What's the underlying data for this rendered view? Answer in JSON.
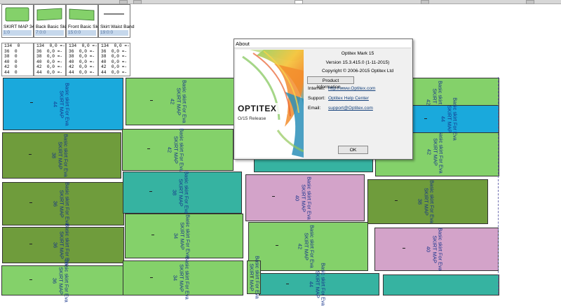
{
  "palette": [
    {
      "name": "SKIRT MAP 34",
      "value": "1:0",
      "color": "#84d16a",
      "shape": "rect"
    },
    {
      "name": "Back Basic Skirt",
      "value": "7:0:0",
      "color": "#84d16a",
      "shape": "trap"
    },
    {
      "name": "Front Basic Skirt",
      "value": "15:0:0",
      "color": "#84d16a",
      "shape": "trap"
    },
    {
      "name": "Skirt Waist Band",
      "value": "19:0:0",
      "color": "#000000",
      "shape": "line"
    }
  ],
  "sizes_table": [
    [
      "134  0",
      "36  0",
      "38  0",
      "40  0",
      "42  0",
      "44  0"
    ],
    [
      "134  0,0 =-",
      "36  0,0 =-",
      "38  0,0 =-",
      "40  0,0 =-",
      "42  0,0 =-",
      "44  0,0 =-"
    ],
    [
      "134  0,0 =-",
      "36  0,0 =-",
      "38  0,0 =-",
      "40  0,0 =-",
      "42  0,0 =-",
      "44  0,0 =-"
    ],
    [
      "134  0,0 =-",
      "36  0,0 =-",
      "38  0,0 =-",
      "40  0,0 =-",
      "42  0,0 =-",
      "44  0,0 =-"
    ]
  ],
  "piece_prefix": "Basic skirt For Eva",
  "piece_map": "SKIRT MAP",
  "pieces": [
    {
      "size": "44",
      "color": "blue"
    },
    {
      "size": "42",
      "color": "lgreen"
    },
    {
      "size": "38",
      "color": "dgreen"
    },
    {
      "size": "42",
      "color": "lgreen"
    },
    {
      "size": "36",
      "color": "dgreen"
    },
    {
      "size": "38",
      "color": "teal"
    },
    {
      "size": "40",
      "color": "pink"
    },
    {
      "size": "38",
      "color": "dgreen"
    },
    {
      "size": "36",
      "color": "dgreen"
    },
    {
      "size": "34",
      "color": "lgreen"
    },
    {
      "size": "42",
      "color": "lgreen"
    },
    {
      "size": "40",
      "color": "pink"
    },
    {
      "size": "36",
      "color": "lgreen"
    },
    {
      "size": "34",
      "color": "lgreen"
    },
    {
      "size": "44",
      "color": "teal"
    },
    {
      "size": "44",
      "color": "teal"
    },
    {
      "size": "42",
      "color": "lgreen"
    },
    {
      "size": "42",
      "color": "lgreen"
    },
    {
      "size": "",
      "color": "teal"
    },
    {
      "size": "44",
      "color": "blue"
    },
    {
      "size": "",
      "color": "lgreen"
    }
  ],
  "about": {
    "title": "About",
    "product": "Optitex Mark 15",
    "version": "Version 15.3.415.0 (1-11-2015)",
    "copyright": "Copyright © 2006-2015 Optitex Ltd",
    "product_info_button": "Product Information...",
    "internet_label": "Internet:",
    "internet_value": "http://www.Optitex.com",
    "support_label": "Support:",
    "support_value": "Optitex Help Center",
    "email_label": "Email:",
    "email_value": "support@Optitex.com",
    "ok_button": "OK",
    "logo_text": "OPTITEX",
    "release_text": "O/15 Release"
  },
  "colors": {
    "blue": "#1aa9dc",
    "lgreen": "#84d16a",
    "dgreen": "#6f9c3c",
    "teal": "#36b3a1",
    "pink": "#d3a3c9"
  }
}
